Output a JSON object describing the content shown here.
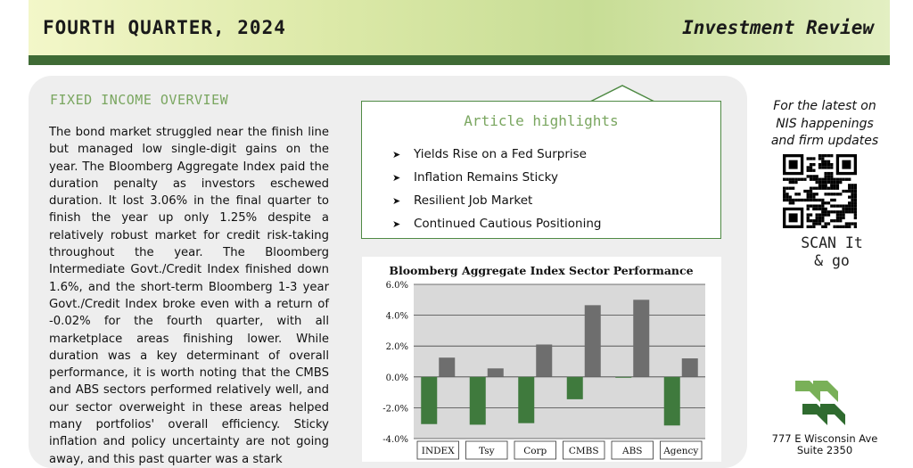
{
  "header": {
    "left_title": "FOURTH QUARTER, 2024",
    "right_title": "Investment Review",
    "accent_color": "#3f6b35"
  },
  "section": {
    "title": "FIXED INCOME OVERVIEW",
    "body": "The bond market struggled near the finish line but managed low single-digit gains on the year.  The Bloomberg Aggregate Index paid the duration penalty as investors eschewed duration.  It lost 3.06% in the final quarter to finish the year up only 1.25% despite a relatively robust market for credit risk-taking throughout the year.   The Bloomberg Intermediate Govt./Credit Index finished down 1.6%, and the short-term Bloomberg 1-3 year Govt./Credit Index broke even with a return of -0.02% for the fourth quarter, with all marketplace areas finishing lower.  While duration was a key determinant of overall performance, it is worth noting that the CMBS and ABS sectors performed relatively well, and our sector overweight in these areas helped many portfolios' overall efficiency.  Sticky inflation and policy uncertainty are not going away, and this past quarter was a stark"
  },
  "highlights": {
    "title": "Article highlights",
    "bullet_icon": "arrow-bullet-icon",
    "items": [
      "Yields Rise on a Fed Surprise",
      "Inflation Remains Sticky",
      "Resilient Job Market",
      "Continued Cautious Positioning"
    ]
  },
  "chart_data": {
    "type": "bar",
    "title": "Bloomberg Aggregate Index Sector Performance",
    "categories": [
      "INDEX",
      "Tsy",
      "Corp",
      "CMBS",
      "ABS",
      "Agency"
    ],
    "series": [
      {
        "color": "#3f7a3d",
        "values": [
          -3.06,
          -3.1,
          -3.0,
          -1.45,
          -0.05,
          -3.15
        ]
      },
      {
        "color": "#6e6e6e",
        "values": [
          1.25,
          0.55,
          2.1,
          4.65,
          5.0,
          1.2
        ]
      }
    ],
    "ylim": [
      -4.0,
      6.0
    ],
    "yticks": [
      "6.0%",
      "4.0%",
      "2.0%",
      "0.0%",
      "-2.0%",
      "-4.0%"
    ],
    "grid": true,
    "plot_background": "#d9d9d9"
  },
  "sidebar": {
    "promo_lines": [
      "For the latest on",
      "NIS happenings",
      "and firm updates"
    ],
    "scan_lines": [
      "SCAN It",
      "& go"
    ],
    "address_lines": [
      "777 E Wisconsin Ave",
      "Suite 2350"
    ]
  }
}
